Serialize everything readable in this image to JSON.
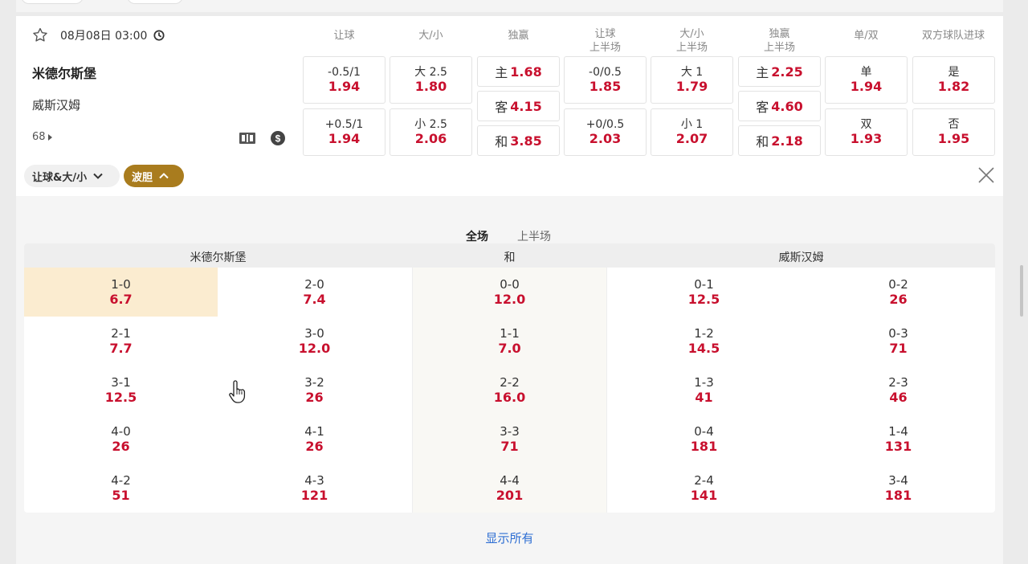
{
  "match": {
    "datetime": "08月08日 03:00",
    "home": "米德尔斯堡",
    "away": "威斯汉姆",
    "more_count": "68"
  },
  "markets": {
    "headers": [
      [
        "让球"
      ],
      [
        "大/小"
      ],
      [
        "独赢"
      ],
      [
        "让球",
        "上半场"
      ],
      [
        "大/小",
        "上半场"
      ],
      [
        "独赢",
        "上半场"
      ],
      [
        "单/双"
      ],
      [
        "双方球队进球"
      ]
    ],
    "handicap": [
      {
        "line": "-0.5/1",
        "odds": "1.94"
      },
      {
        "line": "+0.5/1",
        "odds": "1.94"
      }
    ],
    "overunder": [
      {
        "line": "大 2.5",
        "odds": "1.80"
      },
      {
        "line": "小 2.5",
        "odds": "2.06"
      }
    ],
    "winner": [
      {
        "label": "主",
        "odds": "1.68"
      },
      {
        "label": "客",
        "odds": "4.15"
      },
      {
        "label": "和",
        "odds": "3.85"
      }
    ],
    "handicap_1h": [
      {
        "line": "-0/0.5",
        "odds": "1.85"
      },
      {
        "line": "+0/0.5",
        "odds": "2.03"
      }
    ],
    "overunder_1h": [
      {
        "line": "大 1",
        "odds": "1.79"
      },
      {
        "line": "小 1",
        "odds": "2.07"
      }
    ],
    "winner_1h": [
      {
        "label": "主",
        "odds": "2.25"
      },
      {
        "label": "客",
        "odds": "4.60"
      },
      {
        "label": "和",
        "odds": "2.18"
      }
    ],
    "oddeven": [
      {
        "label": "单",
        "odds": "1.94"
      },
      {
        "label": "双",
        "odds": "1.93"
      }
    ],
    "btts": [
      {
        "label": "是",
        "odds": "1.82"
      },
      {
        "label": "否",
        "odds": "1.95"
      }
    ]
  },
  "tabs": {
    "t1": "让球&大/小",
    "t2": "波胆"
  },
  "correct_score": {
    "periods": [
      "全场",
      "上半场"
    ],
    "headers": {
      "home": "米德尔斯堡",
      "draw": "和",
      "away": "威斯汉姆"
    },
    "columns": [
      [
        {
          "s": "1-0",
          "o": "6.7"
        },
        {
          "s": "2-1",
          "o": "7.7"
        },
        {
          "s": "3-1",
          "o": "12.5"
        },
        {
          "s": "4-0",
          "o": "26"
        },
        {
          "s": "4-2",
          "o": "51"
        }
      ],
      [
        {
          "s": "2-0",
          "o": "7.4"
        },
        {
          "s": "3-0",
          "o": "12.0"
        },
        {
          "s": "3-2",
          "o": "26"
        },
        {
          "s": "4-1",
          "o": "26"
        },
        {
          "s": "4-3",
          "o": "121"
        }
      ],
      [
        {
          "s": "0-0",
          "o": "12.0"
        },
        {
          "s": "1-1",
          "o": "7.0"
        },
        {
          "s": "2-2",
          "o": "16.0"
        },
        {
          "s": "3-3",
          "o": "71"
        },
        {
          "s": "4-4",
          "o": "201"
        }
      ],
      [
        {
          "s": "0-1",
          "o": "12.5"
        },
        {
          "s": "1-2",
          "o": "14.5"
        },
        {
          "s": "1-3",
          "o": "41"
        },
        {
          "s": "0-4",
          "o": "181"
        },
        {
          "s": "2-4",
          "o": "141"
        }
      ],
      [
        {
          "s": "0-2",
          "o": "26"
        },
        {
          "s": "0-3",
          "o": "71"
        },
        {
          "s": "2-3",
          "o": "46"
        },
        {
          "s": "1-4",
          "o": "131"
        },
        {
          "s": "3-4",
          "o": "181"
        }
      ]
    ],
    "show_all": "显示所有"
  },
  "colors": {
    "odds": "#c8102e",
    "accent": "#a97c1e",
    "highlight": "#fbecd0",
    "link": "#2f6fd3"
  }
}
